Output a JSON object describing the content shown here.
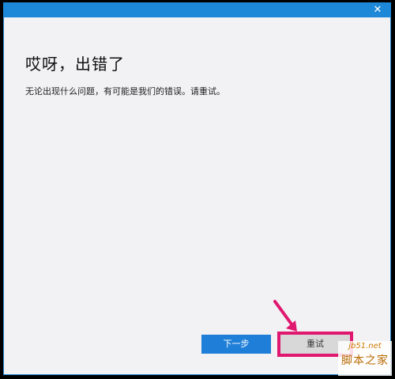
{
  "dialog": {
    "title": "哎呀，出错了",
    "message": "无论出现什么问题，有可能是我们的错误。请重试。",
    "close_glyph": "✕",
    "accent_color": "#1e88d8"
  },
  "buttons": {
    "next_label": "下一步",
    "retry_label": "重试"
  },
  "annotation": {
    "highlight_color": "#e0176f"
  },
  "watermark": {
    "domain": "jb51.net",
    "site_name": "脚本之家"
  }
}
